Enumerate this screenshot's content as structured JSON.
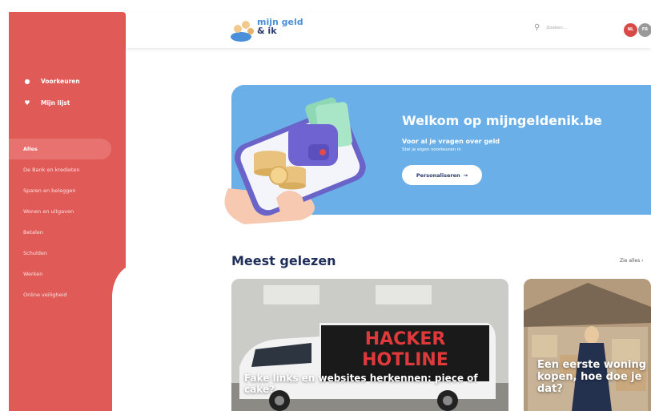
{
  "sidebar": {
    "preferences": [
      {
        "label": "Voorkeuren",
        "icon": "user-icon"
      },
      {
        "label": "Mijn lijst",
        "icon": "heart-icon"
      }
    ],
    "nav_items": [
      {
        "label": "Alles",
        "active": true
      },
      {
        "label": "De Bank en kredieten",
        "active": false
      },
      {
        "label": "Sparen en beleggen",
        "active": false
      },
      {
        "label": "Wonen en uitgaven",
        "active": false
      },
      {
        "label": "Betalen",
        "active": false
      },
      {
        "label": "Schulden",
        "active": false
      },
      {
        "label": "Werken",
        "active": false
      },
      {
        "label": "Online veiligheid",
        "active": false
      }
    ]
  },
  "header": {
    "logo": {
      "line1": "mijn geld",
      "line2": "& ik"
    },
    "search": {
      "placeholder": "Zoeken..."
    },
    "languages": [
      "NL",
      "FR"
    ]
  },
  "hero": {
    "title": "Welkom op mijngeldenik.be",
    "subtitle": "Voor al je vragen over geld",
    "description": "Stel je eigen voorkeuren in",
    "button_label": "Personaliseren",
    "button_arrow": "→"
  },
  "section": {
    "title": "Meest gelezen",
    "see_all": "Zie alles"
  },
  "cards": [
    {
      "title": "Fake links en websites herkennen: piece of cake?",
      "image_text": [
        "HACKER",
        "HOTLINE"
      ]
    },
    {
      "title": "Een eerste woning kopen, hoe doe je dat?"
    }
  ],
  "colors": {
    "sidebar": "#e05a57",
    "hero": "#6aafe8",
    "heading": "#1f2d5a"
  }
}
